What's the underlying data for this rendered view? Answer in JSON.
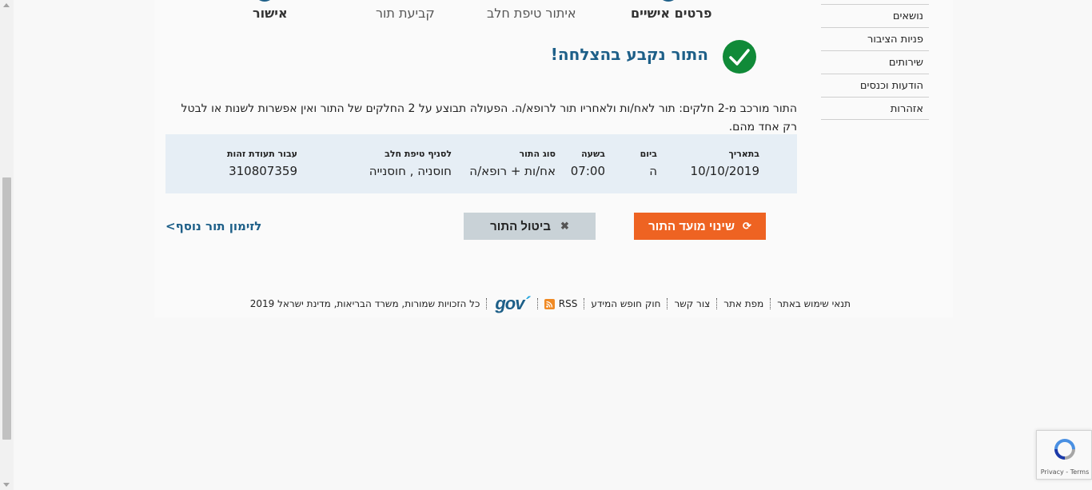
{
  "steps": [
    {
      "label": "אישור",
      "active": true
    },
    {
      "label": "קביעת תור",
      "active": false
    },
    {
      "label": "איתור טיפת חלב",
      "active": false
    },
    {
      "label": "פרטים אישיים",
      "active": true
    }
  ],
  "side_menu": [
    "נושאים",
    "פניות הציבור",
    "שירותים",
    "הודעות וכנסים",
    "אזהרות"
  ],
  "success": {
    "title": "התור נקבע בהצלחה!",
    "description": "התור מורכב מ-2 חלקים: תור לאח/ות ולאחריו תור לרופא/ה. הפעולה תבוצע על 2 החלקים של התור ואין אפשרות לשנות או לבטל רק אחד מהם."
  },
  "appointment": {
    "date_label": "בתאריך",
    "date": "10/10/2019",
    "day_label": "ביום",
    "day": "ה",
    "time_label": "בשעה",
    "time": "07:00",
    "type_label": "סוג התור",
    "type": "אח/ות + רופא/ה",
    "branch_label": "לסניף טיפת חלב",
    "branch": "חוסניה , חוסנייה",
    "id_label": "עבור תעודת זהות",
    "id_number": "310807359"
  },
  "actions": {
    "change_label": "שינוי מועד התור",
    "cancel_label": "ביטול התור",
    "another_label": "לזימון תור נוסף>"
  },
  "footer": {
    "terms": "תנאי שימוש באתר",
    "sitemap": "מפת אתר",
    "contact": "צור קשר",
    "foi": "חוק חופש המידע",
    "rss": "RSS",
    "logo": "gov",
    "copyright": "כל הזכויות שמורות, משרד הבריאות, מדינת ישראל 2019"
  },
  "recaptcha": {
    "text": "Privacy - Terms"
  },
  "colors": {
    "brand_blue": "#1d5f88",
    "success_green": "#108a38",
    "orange": "#ee6322",
    "details_bg": "#e6eef5"
  },
  "icons": {
    "success": "check-icon",
    "change": "refresh-icon",
    "cancel": "x-icon",
    "rss": "rss-icon"
  }
}
